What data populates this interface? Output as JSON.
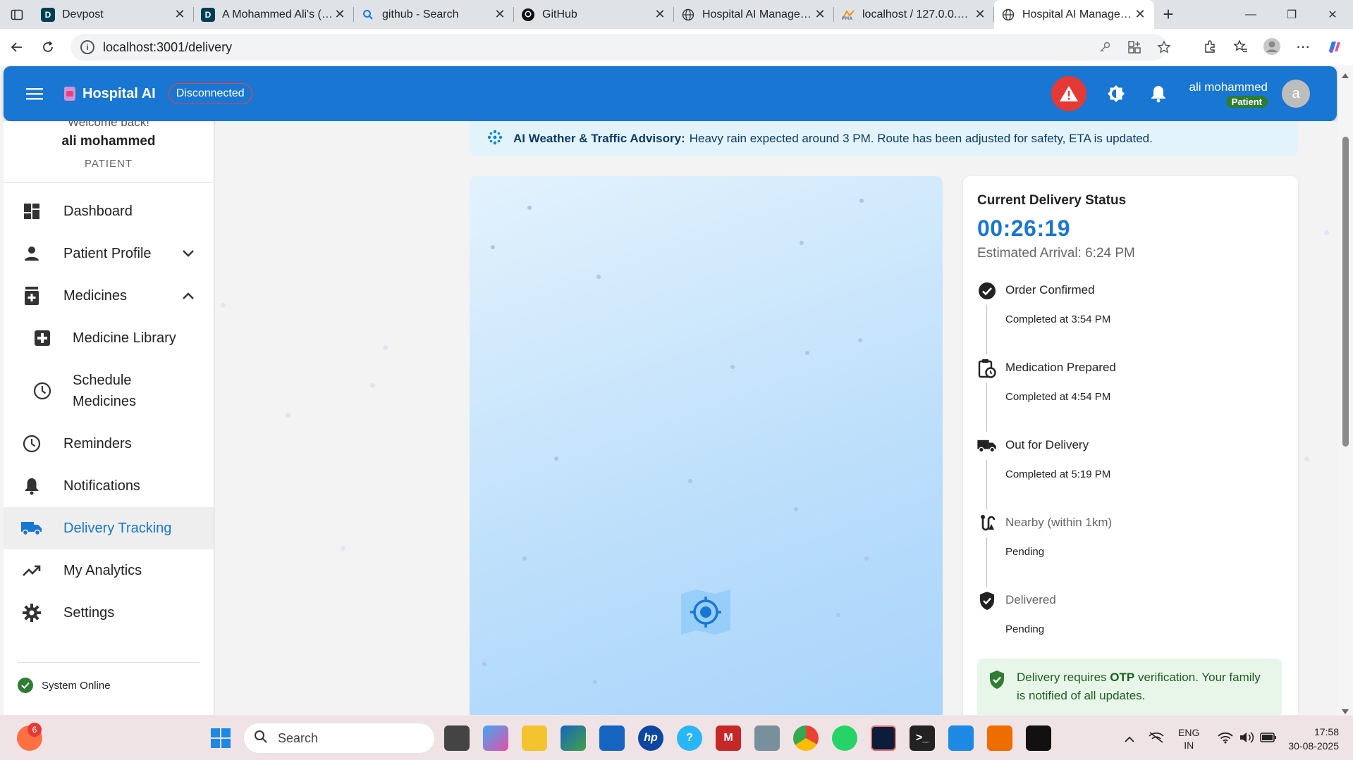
{
  "browser": {
    "tabs": [
      {
        "title": "Devpost",
        "favicon": "D",
        "color": "#003e54"
      },
      {
        "title": "A Mohammed Ali's (an",
        "favicon": "D",
        "color": "#003e54"
      },
      {
        "title": "github - Search",
        "favicon": "search-icon",
        "color": "#1a73e8"
      },
      {
        "title": "GitHub",
        "favicon": "github-icon",
        "color": "#111111"
      },
      {
        "title": "Hospital AI Manageme",
        "favicon": "globe-icon",
        "color": "#333333"
      },
      {
        "title": "localhost / 127.0.0.1 | p",
        "favicon": "pma-icon",
        "color": "#f29111"
      },
      {
        "title": "Hospital AI Manageme",
        "favicon": "globe-icon",
        "color": "#333333"
      }
    ],
    "url": "localhost:3001/delivery"
  },
  "app": {
    "brand": "Hospital AI",
    "connection_status": "Disconnected",
    "user_name": "ali mohammed",
    "user_role_chip": "Patient",
    "avatar_letter": "a",
    "accent_color": "#1976d2"
  },
  "sidebar": {
    "welcome": "Welcome back!",
    "name": "ali mohammed",
    "role": "PATIENT",
    "items": [
      {
        "label": "Dashboard",
        "icon": "dashboard-icon"
      },
      {
        "label": "Patient Profile",
        "icon": "person-icon"
      },
      {
        "label": "Medicines",
        "icon": "medication-icon"
      },
      {
        "label": "Medicine Library",
        "icon": "medical-plus-icon"
      },
      {
        "label": "Schedule\nMedicines",
        "icon": "clock-icon"
      },
      {
        "label": "Reminders",
        "icon": "clock-icon"
      },
      {
        "label": "Notifications",
        "icon": "bell-icon"
      },
      {
        "label": "Delivery Tracking",
        "icon": "truck-icon"
      },
      {
        "label": "My Analytics",
        "icon": "trending-up-icon"
      },
      {
        "label": "Settings",
        "icon": "gear-icon"
      }
    ],
    "system_status": "System Online"
  },
  "advisory": {
    "title": "AI Weather & Traffic Advisory:",
    "message": "Heavy rain expected around 3 PM. Route has been adjusted for safety, ETA is updated."
  },
  "delivery": {
    "card_title": "Current Delivery Status",
    "timer": "00:26:19",
    "eta": "Estimated Arrival: 6:24 PM",
    "steps": [
      {
        "label": "Order Confirmed",
        "status": "Completed at 3:54 PM",
        "icon": "check-circle-icon"
      },
      {
        "label": "Medication Prepared",
        "status": "Completed at 4:54 PM",
        "icon": "clipboard-clock-icon"
      },
      {
        "label": "Out for Delivery",
        "status": "Completed at 5:19 PM",
        "icon": "truck-icon"
      },
      {
        "label": "Nearby (within 1km)",
        "status": "Pending",
        "icon": "route-icon"
      },
      {
        "label": "Delivered",
        "status": "Pending",
        "icon": "verified-shield-icon"
      }
    ],
    "otp_pre": "Delivery requires ",
    "otp_bold": "OTP",
    "otp_post": " verification. Your family is notified of all updates."
  },
  "taskbar": {
    "search_placeholder": "Search",
    "notification_count": "6",
    "lang_1": "ENG",
    "lang_2": "IN",
    "time": "17:58",
    "date": "30-08-2025"
  }
}
